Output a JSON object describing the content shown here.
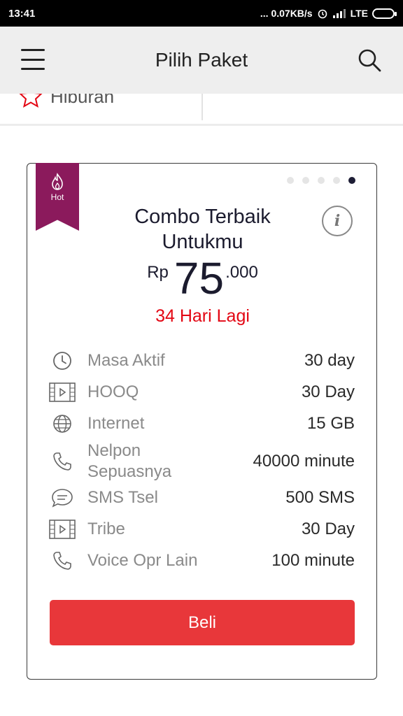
{
  "status_bar": {
    "time": "13:41",
    "network_speed": "... 0.07KB/s",
    "signal": "LTE"
  },
  "header": {
    "title": "Pilih Paket",
    "menu_icon": "hamburger-menu-icon",
    "search_icon": "search-icon"
  },
  "category": {
    "label": "Hiburan",
    "icon": "star-outline-icon"
  },
  "package": {
    "badge": "Hot",
    "title_line1": "Combo Terbaik",
    "title_line2": "Untukmu",
    "currency": "Rp",
    "price_main": "75",
    "price_decimal": ".000",
    "countdown": "34 Hari Lagi",
    "carousel_total": 5,
    "carousel_active": 5,
    "details": [
      {
        "icon": "clock-icon",
        "label": "Masa Aktif",
        "value": "30 day"
      },
      {
        "icon": "video-film-icon",
        "label": "HOOQ",
        "value": "30 Day"
      },
      {
        "icon": "globe-icon",
        "label": "Internet",
        "value": "15 GB"
      },
      {
        "icon": "phone-icon",
        "label": "Nelpon Sepuasnya",
        "value": "40000 minute"
      },
      {
        "icon": "chat-bubble-icon",
        "label": "SMS Tsel",
        "value": "500 SMS"
      },
      {
        "icon": "video-film-icon",
        "label": "Tribe",
        "value": "30 Day"
      },
      {
        "icon": "phone-icon",
        "label": "Voice Opr Lain",
        "value": "100 minute"
      }
    ],
    "buy_label": "Beli"
  },
  "colors": {
    "ribbon": "#8b1a5c",
    "accent_red": "#e8373a",
    "countdown_red": "#e30613"
  }
}
